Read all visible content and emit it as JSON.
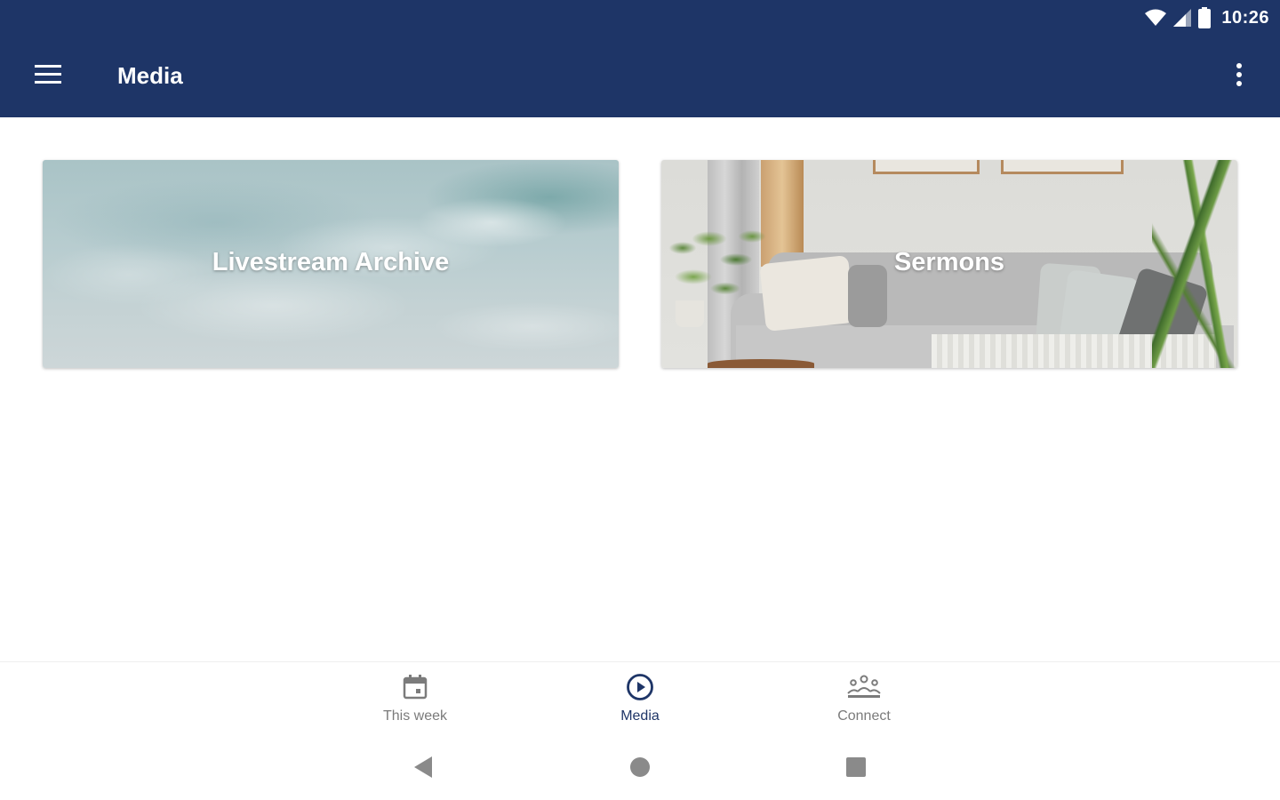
{
  "status_bar": {
    "time": "10:26",
    "icons": [
      "wifi-icon",
      "cell-signal-icon",
      "battery-icon"
    ]
  },
  "app_bar": {
    "title": "Media",
    "menu_icon": "hamburger-menu-icon",
    "more_icon": "more-vert-icon",
    "color": "#1e3567"
  },
  "cards": [
    {
      "label": "Livestream Archive",
      "image": "ocean-waves-image"
    },
    {
      "label": "Sermons",
      "image": "living-room-image"
    }
  ],
  "bottom_nav": {
    "active": "Media",
    "active_color": "#1e3567",
    "items": [
      {
        "label": "This week",
        "icon": "calendar-icon"
      },
      {
        "label": "Media",
        "icon": "play-circle-icon"
      },
      {
        "label": "Connect",
        "icon": "group-icon"
      }
    ]
  },
  "system_nav": {
    "icons": [
      "back-triangle-icon",
      "home-circle-icon",
      "recents-square-icon"
    ]
  }
}
